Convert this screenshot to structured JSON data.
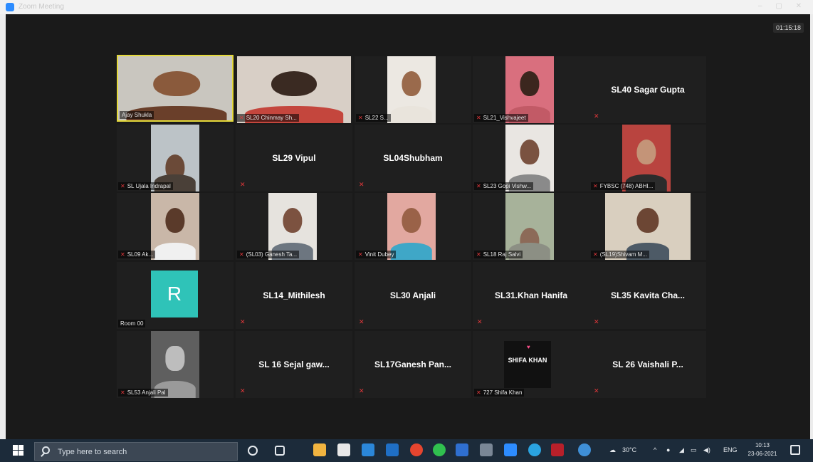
{
  "window": {
    "title": "Zoom Meeting"
  },
  "meeting": {
    "timer": "01:15:18"
  },
  "tiles": [
    {
      "label": "Ajay Shukla",
      "muted": false
    },
    {
      "label": "SL20 Chinmay Sh...",
      "muted": true
    },
    {
      "label": "SL22 S...",
      "muted": true
    },
    {
      "label": "SL21_Vishvajeet",
      "muted": true
    },
    {
      "name": "SL40  Sagar Gupta",
      "muted": true
    },
    {
      "label": "SL Ujala Indrapal",
      "muted": true
    },
    {
      "name": "SL29 Vipul",
      "muted": true
    },
    {
      "name": "SL04Shubham",
      "muted": true
    },
    {
      "label": "SL23  Gopi Vishw...",
      "muted": true
    },
    {
      "label": "FYBSC (748) ABHI...",
      "muted": true
    },
    {
      "label": "SL09 Ak...",
      "muted": true
    },
    {
      "label": "(SL03) Ganesh Ta...",
      "muted": true
    },
    {
      "label": "Vinit Dubey",
      "muted": true
    },
    {
      "label": "SL18 Raj Salvi",
      "muted": true
    },
    {
      "label": "(SL19)Shivam M...",
      "muted": true
    },
    {
      "label": "Room 00",
      "avatar": "R",
      "muted": false
    },
    {
      "name": "SL14_Mithilesh",
      "muted": true
    },
    {
      "name": "SL30  Anjali",
      "muted": true
    },
    {
      "name": "SL31.Khan Hanifa",
      "muted": true
    },
    {
      "name": "SL35  Kavita Cha...",
      "muted": true
    },
    {
      "label": "SL53  Anjali Pal",
      "muted": true
    },
    {
      "name": "SL 16  Sejal gaw...",
      "muted": true
    },
    {
      "name": "SL17Ganesh  Pan...",
      "muted": true
    },
    {
      "label": "727  Shifa Khan",
      "logo_text": "SHIFA KHAN",
      "muted": true
    },
    {
      "name": "SL 26  Vaishali P...",
      "muted": true
    }
  ],
  "taskbar": {
    "search_placeholder": "Type here to search",
    "weather": "30°C",
    "language": "ENG",
    "time": "10:13",
    "date": "23-06-2021"
  },
  "colors": {
    "stage_bg": "#1a1a1a",
    "active_speaker_border": "#e4d93b",
    "mute_icon": "#e0373a",
    "avatar_bg": "#2fc3b8",
    "taskbar_bg": "#1c2b3a"
  }
}
